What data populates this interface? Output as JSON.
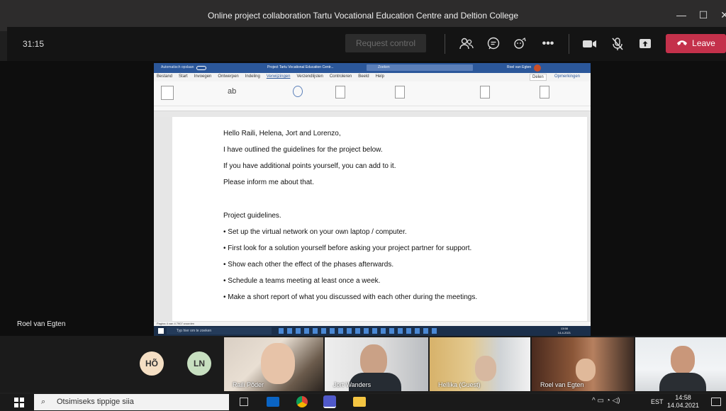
{
  "window": {
    "title": "Online project collaboration Tartu Vocational Education Centre and Deltion College"
  },
  "meeting": {
    "timer": "31:15",
    "request_control_label": "Request control",
    "leave_label": "Leave",
    "leave_color": "#c4314b",
    "presenter_name": "Roel van Egten"
  },
  "document": {
    "lines": [
      "Hello Raili, Helena, Jort and Lorenzo,",
      "I have outlined the guidelines for the project below.",
      "If you have additional points yourself, you can add to it.",
      "Please inform me about that.",
      "Project guidelines.",
      "• Set up the virtual network on your own laptop / computer.",
      "• First look for a solution yourself before asking your project partner for support.",
      "• Show each other the effect of the phases afterwards.",
      "• Schedule a teams meeting at least once a week.",
      "• Make a short report of what you discussed with each other during the meetings."
    ]
  },
  "word_app": {
    "tabs": [
      "Bestand",
      "Start",
      "Invoegen",
      "Ontwerpen",
      "Indeling",
      "Verwijzingen",
      "Verzendlijsten",
      "Controleren",
      "Beeld",
      "Help"
    ],
    "share_label": "Delen",
    "comments_label": "Opmerkingen",
    "search_placeholder": "Zoeken",
    "doc_title": "Project Tartu Vocational Education Centr...",
    "user_name": "Roel van Egten",
    "status_text": "Pagina 4 van 4   7907 woorden",
    "taskbar_search": "Typ hier om te zoeken",
    "inner_time": "13:58",
    "inner_date": "14-4-2021"
  },
  "participants": {
    "initials": [
      {
        "text": "HÕ",
        "color": "#f5dfc4"
      },
      {
        "text": "LN",
        "color": "#c7dfc0"
      }
    ],
    "video_tiles": [
      {
        "name": "Raili Põder"
      },
      {
        "name": "Jort Wanders"
      },
      {
        "name": "Hellika (Guest)"
      },
      {
        "name": "Roel van Egten"
      },
      {
        "name": ""
      }
    ]
  },
  "taskbar": {
    "search_placeholder": "Otsimiseks tippige siia",
    "language": "EST",
    "time": "14:58",
    "date": "14.04.2021"
  }
}
